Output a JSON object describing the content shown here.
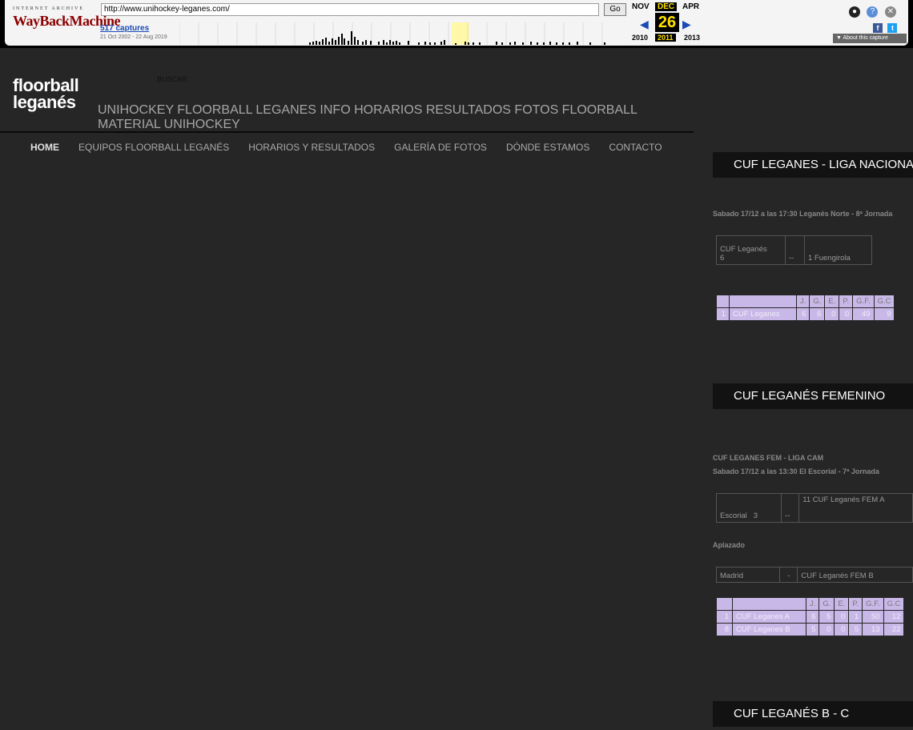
{
  "wayback": {
    "logo_top": "INTERNET ARCHIVE",
    "logo_bottom": "WayBackMachine",
    "url": "http://www.unihockey-leganes.com/",
    "go_label": "Go",
    "captures": "517 captures",
    "date_range": "21 Oct 2002 - 22 Aug 2019",
    "months": {
      "prev": "NOV",
      "current": "DEC",
      "next": "APR"
    },
    "day": "26",
    "years": {
      "prev": "2010",
      "current": "2011",
      "next": "2013"
    },
    "about_label": "About this capture"
  },
  "site": {
    "logo_line1": "floorball",
    "logo_line2": "leganés",
    "search_label": "BUSCAR",
    "tagline": "UNIHOCKEY FLOORBALL LEGANES INFO HORARIOS RESULTADOS FOTOS FLOORBALL MATERIAL UNIHOCKEY",
    "nav": [
      "HOME",
      "EQUIPOS FLOORBALL LEGANÉS",
      "HORARIOS Y RESULTADOS",
      "GALERÍA DE FOTOS",
      "DÓNDE ESTAMOS",
      "CONTACTO"
    ]
  },
  "sidebar": {
    "section1": {
      "title": "CUF LEGANES - LIGA NACIONAL",
      "match_info": "Sabado 17/12 a las 17:30 Leganés Norte - 8ª Jornada",
      "score": {
        "home": "CUF Leganés",
        "home_score": "6",
        "sep": "--",
        "away": "1 Fuengirola"
      },
      "standings_headers": [
        "",
        "",
        "J.",
        "G.",
        "E.",
        "P.",
        "G.F.",
        "G.C"
      ],
      "standings_rows": [
        [
          "1",
          "CUF Leganes",
          "6",
          "6",
          "0",
          "0",
          "49",
          "9"
        ]
      ]
    },
    "section2": {
      "title": "CUF LEGANÉS FEMENINO",
      "league": "CUF LEGANES FEM - LIGA CAM",
      "match_info": "Sabado 17/12 a las 13:30 El Escorial - 7ª Jornada",
      "score1": {
        "home": "Escorial",
        "home_score": "3",
        "sep": "--",
        "away": "11  CUF Leganés  FEM A"
      },
      "postponed": "Aplazado",
      "score2": {
        "home": "Madrid",
        "sep": "-",
        "away": "CUF Leganés  FEM B"
      },
      "standings_headers": [
        "",
        "",
        "J.",
        "G.",
        "E.",
        "P.",
        "G.F.",
        "G.C"
      ],
      "standings_rows": [
        [
          "1",
          "CUF Leganes A",
          "6",
          "5",
          "0",
          "1",
          "50",
          "12"
        ],
        [
          "8",
          "CUF Leganes B",
          "5",
          "0",
          "0",
          "5",
          "13",
          "22"
        ]
      ]
    },
    "section3": {
      "title": "CUF LEGANÉS B - C"
    }
  }
}
